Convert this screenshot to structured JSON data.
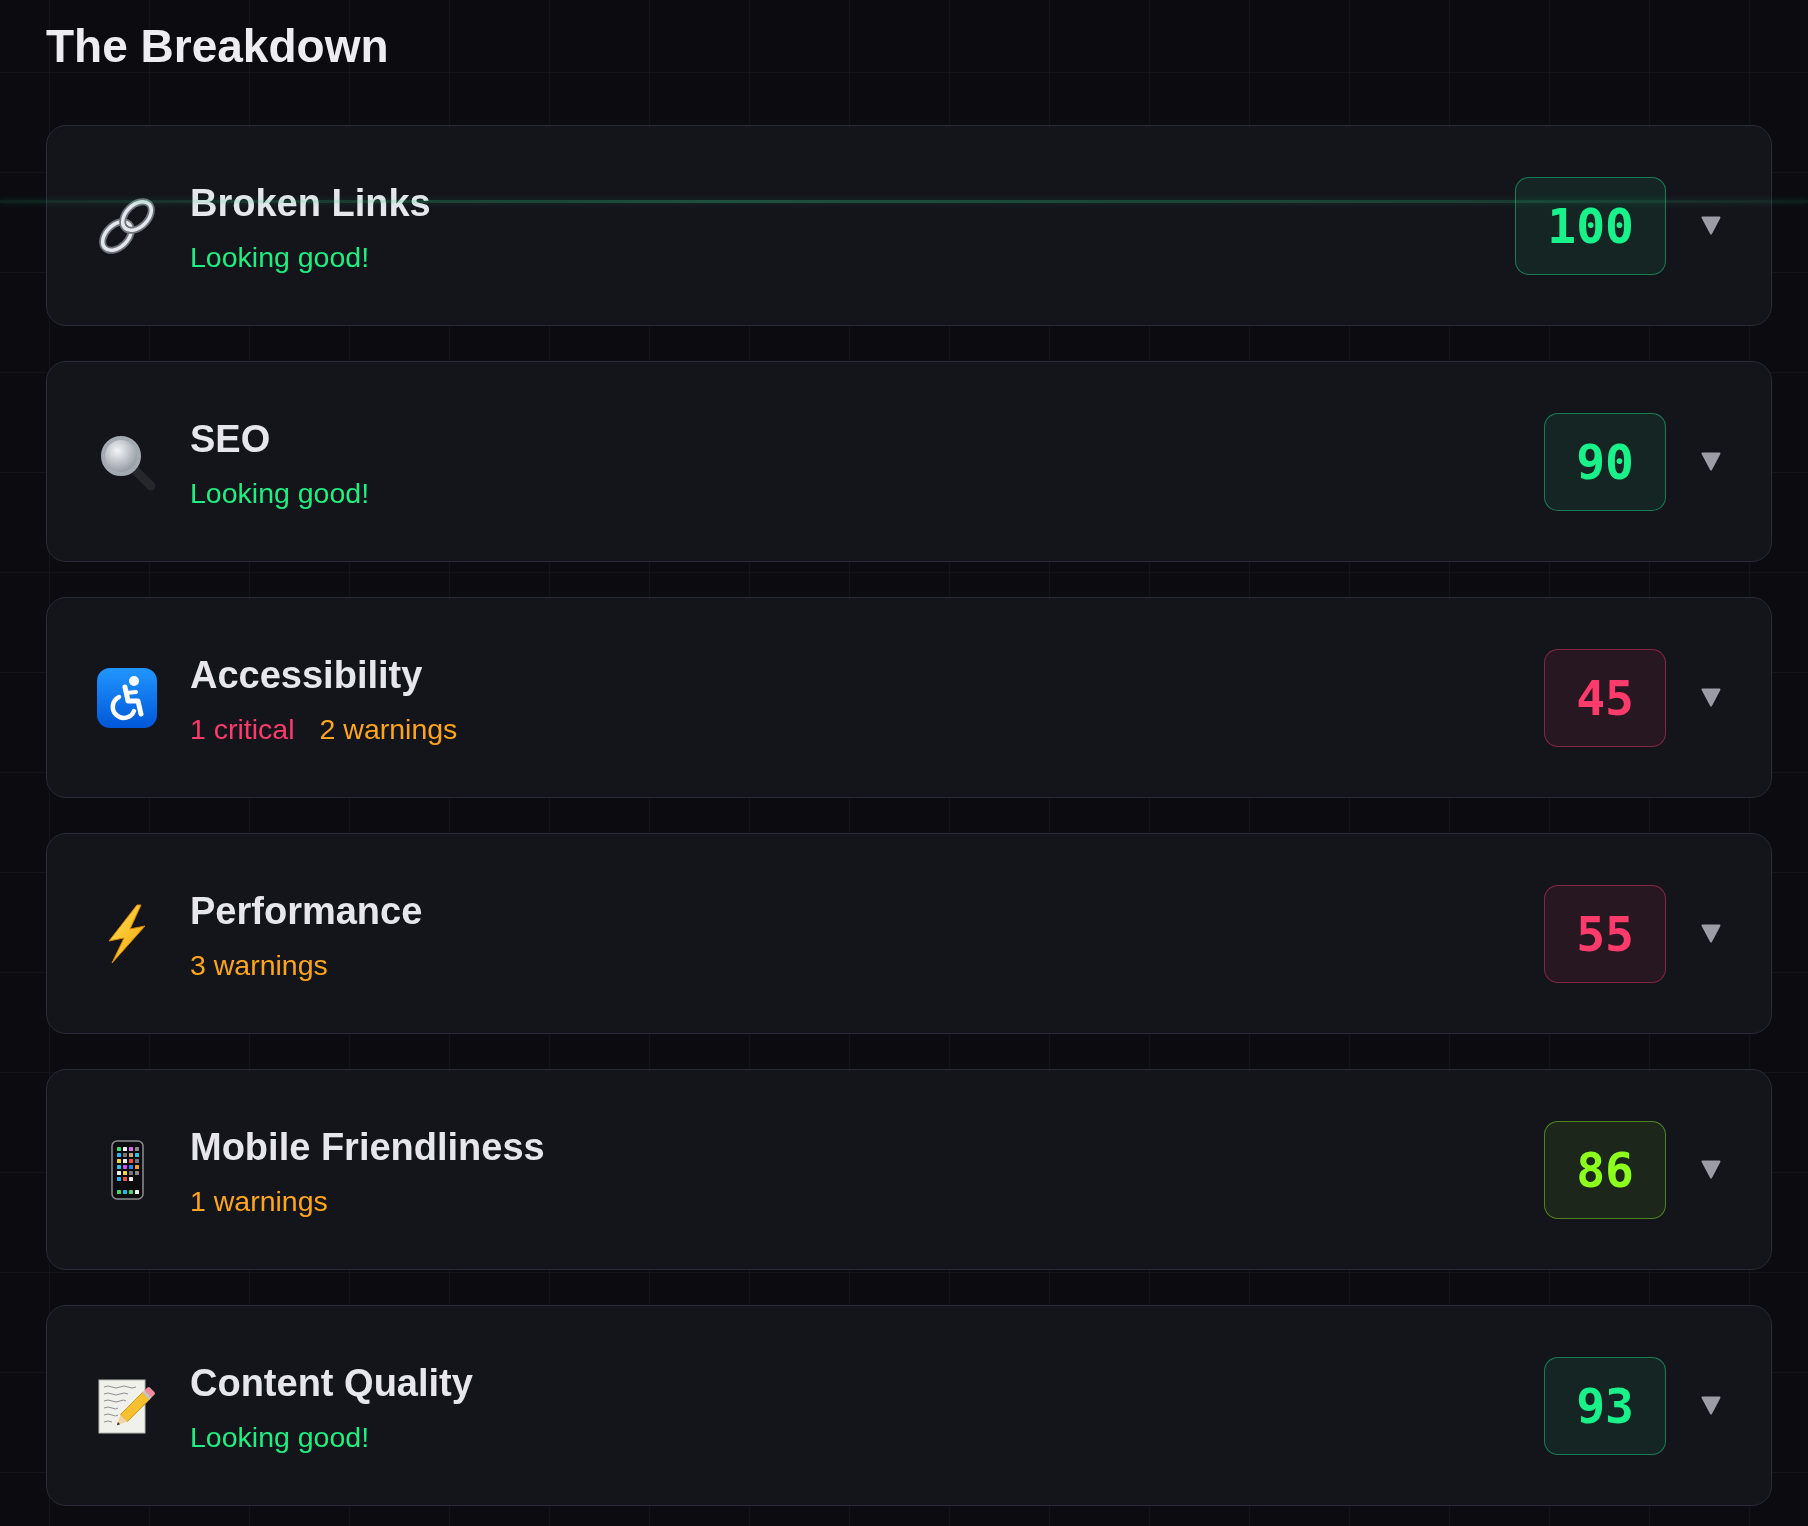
{
  "title": "The Breakdown",
  "categories": [
    {
      "name": "Broken Links",
      "status": [
        {
          "kind": "ok",
          "text": "Looking good!"
        }
      ],
      "score": {
        "value": "100",
        "color": "#19f28a"
      },
      "expanded": false
    },
    {
      "name": "SEO",
      "status": [
        {
          "kind": "ok",
          "text": "Looking good!"
        }
      ],
      "score": {
        "value": "90",
        "color": "#19f28a"
      },
      "expanded": false
    },
    {
      "name": "Accessibility",
      "status": [
        {
          "kind": "critical",
          "text": "1 critical"
        },
        {
          "kind": "warning",
          "text": "2 warnings"
        }
      ],
      "score": {
        "value": "45",
        "color": "#ff3b6c"
      },
      "expanded": false
    },
    {
      "name": "Performance",
      "status": [
        {
          "kind": "warning",
          "text": "3 warnings"
        }
      ],
      "score": {
        "value": "55",
        "color": "#ff3b6c"
      },
      "expanded": false
    },
    {
      "name": "Mobile Friendliness",
      "status": [
        {
          "kind": "warning",
          "text": "1 warnings"
        }
      ],
      "score": {
        "value": "86",
        "color": "#8cff1c"
      },
      "expanded": false
    },
    {
      "name": "Content Quality",
      "status": [
        {
          "kind": "ok",
          "text": "Looking good!"
        }
      ],
      "score": {
        "value": "93",
        "color": "#19f28a"
      },
      "expanded": false
    }
  ]
}
